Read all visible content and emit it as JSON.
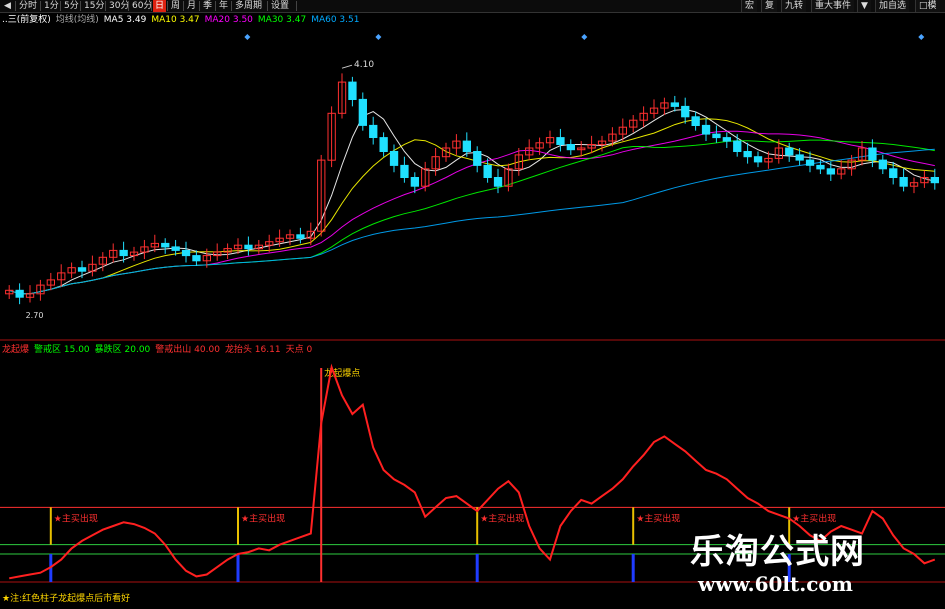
{
  "toolbar": {
    "items": [
      {
        "label": "◀",
        "active": false
      },
      {
        "label": "分时",
        "active": false
      },
      {
        "label": "1分",
        "active": false
      },
      {
        "label": "5分",
        "active": false
      },
      {
        "label": "15分",
        "active": false
      },
      {
        "label": "30分",
        "active": false
      },
      {
        "label": "60分",
        "active": false
      },
      {
        "label": "日",
        "active": true
      },
      {
        "label": "周",
        "active": false
      },
      {
        "label": "月",
        "active": false
      },
      {
        "label": "季",
        "active": false
      },
      {
        "label": "年",
        "active": false
      },
      {
        "label": "多周期",
        "active": false
      },
      {
        "label": "设置",
        "active": false
      }
    ],
    "right_controls": [
      "宏",
      "复",
      "九转",
      "重大事件",
      "▼",
      "加自选",
      "□模"
    ]
  },
  "main_legend": {
    "stock": "..三(前复权)",
    "ma_label": "均线(均线)",
    "items": [
      {
        "label": "MA5",
        "value": "3.49",
        "color": "#ffffff"
      },
      {
        "label": "MA10",
        "value": "3.47",
        "color": "#ffff00"
      },
      {
        "label": "MA20",
        "value": "3.50",
        "color": "#ff00ff"
      },
      {
        "label": "MA30",
        "value": "3.47",
        "color": "#00ff00"
      },
      {
        "label": "MA60",
        "value": "3.51",
        "color": "#00aaff"
      }
    ]
  },
  "indicator_legend": {
    "name": "龙起爆",
    "items": [
      {
        "label": "警戒区",
        "value": "15.00",
        "color": "#00ff00"
      },
      {
        "label": "暴跌区",
        "value": "20.00",
        "color": "#00ff00"
      },
      {
        "label": "警戒出山",
        "value": "40.00",
        "color": "#ff3030"
      },
      {
        "label": "龙抬头",
        "value": "16.11",
        "color": "#ff3030"
      },
      {
        "label": "天点",
        "value": "0",
        "color": "#ff3030"
      }
    ]
  },
  "annotations": {
    "peak_price": "4.10",
    "low_price": "2.70",
    "breakout_label": "龙起爆点",
    "signal_label": "★主买出现",
    "bottom_note": "★注:红色柱子龙起爆点后市看好"
  },
  "watermark": {
    "title": "乐淘公式网",
    "url": "www.60lt.com"
  },
  "chart_data": {
    "type": "candlestick",
    "main_panel": {
      "price_range": [
        2.6,
        4.3
      ],
      "close": [
        2.8,
        2.76,
        2.78,
        2.83,
        2.86,
        2.9,
        2.93,
        2.91,
        2.95,
        2.99,
        3.03,
        3.0,
        3.02,
        3.05,
        3.07,
        3.05,
        3.03,
        3.0,
        2.97,
        3.0,
        3.02,
        3.04,
        3.06,
        3.04,
        3.06,
        3.08,
        3.1,
        3.12,
        3.1,
        3.14,
        3.55,
        3.82,
        4.0,
        3.9,
        3.75,
        3.68,
        3.6,
        3.52,
        3.45,
        3.4,
        3.5,
        3.57,
        3.62,
        3.66,
        3.6,
        3.52,
        3.45,
        3.4,
        3.5,
        3.58,
        3.62,
        3.65,
        3.68,
        3.64,
        3.61,
        3.62,
        3.64,
        3.66,
        3.7,
        3.74,
        3.78,
        3.82,
        3.85,
        3.88,
        3.86,
        3.8,
        3.75,
        3.7,
        3.68,
        3.66,
        3.6,
        3.57,
        3.54,
        3.56,
        3.62,
        3.58,
        3.55,
        3.52,
        3.5,
        3.47,
        3.5,
        3.55,
        3.62,
        3.55,
        3.5,
        3.45,
        3.4,
        3.42,
        3.45,
        3.42
      ]
    },
    "indicator_panel": {
      "value_range": [
        0,
        120
      ],
      "levels": {
        "警戒区": 15,
        "暴跌区": 20,
        "警戒出山": 40
      },
      "values": [
        2,
        3,
        4,
        5,
        8,
        12,
        18,
        22,
        25,
        28,
        30,
        32,
        31,
        29,
        26,
        20,
        12,
        6,
        3,
        4,
        8,
        12,
        15,
        16,
        18,
        17,
        20,
        22,
        24,
        26,
        85,
        115,
        100,
        90,
        95,
        72,
        60,
        55,
        52,
        48,
        35,
        40,
        45,
        46,
        42,
        38,
        44,
        50,
        54,
        48,
        30,
        18,
        12,
        30,
        38,
        44,
        42,
        46,
        50,
        55,
        62,
        68,
        75,
        78,
        74,
        70,
        65,
        60,
        58,
        55,
        50,
        45,
        42,
        38,
        36,
        34,
        30,
        25,
        22,
        27,
        30,
        28,
        26,
        38,
        34,
        25,
        18,
        15,
        10,
        12
      ],
      "signal_indices": [
        4,
        22,
        45,
        60,
        75
      ]
    }
  }
}
